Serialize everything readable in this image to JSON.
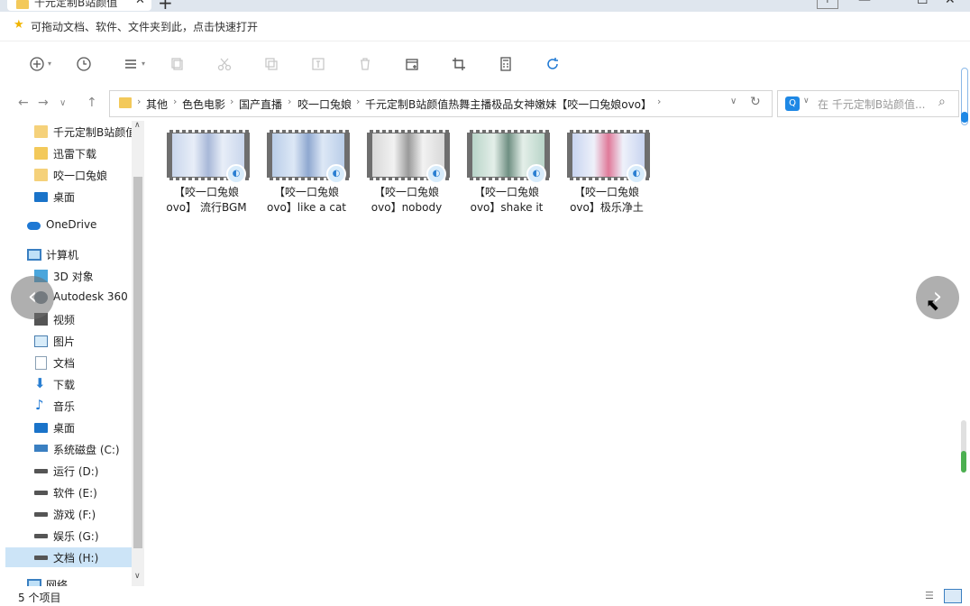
{
  "tab": {
    "title": "千元定制B站颜值",
    "close": "✕",
    "new": "+"
  },
  "window": {
    "minimize": "—",
    "maximize": "☐",
    "close": "✕"
  },
  "quickbar": {
    "text": "可拖动文档、软件、文件夹到此，点击快速打开"
  },
  "breadcrumb": [
    "其他",
    "色色电影",
    "国产直播",
    "咬一口兔娘",
    "千元定制B站颜值热舞主播极品女神嫩妹【咬一口兔娘ovo】"
  ],
  "search": {
    "placeholder": "在 千元定制B站颜值..."
  },
  "sidebar": {
    "items": [
      {
        "label": "千元定制B站颜值"
      },
      {
        "label": "迅雷下载"
      },
      {
        "label": "咬一口兔娘"
      },
      {
        "label": "桌面"
      },
      {
        "label": "OneDrive"
      },
      {
        "label": "计算机"
      },
      {
        "label": "3D 对象"
      },
      {
        "label": "Autodesk 360"
      },
      {
        "label": "视频"
      },
      {
        "label": "图片"
      },
      {
        "label": "文档"
      },
      {
        "label": "下载"
      },
      {
        "label": "音乐"
      },
      {
        "label": "桌面"
      },
      {
        "label": "系统磁盘 (C:)"
      },
      {
        "label": "运行 (D:)"
      },
      {
        "label": "软件 (E:)"
      },
      {
        "label": "游戏 (F:)"
      },
      {
        "label": "娱乐 (G:)"
      },
      {
        "label": "文档 (H:)"
      },
      {
        "label": "网络"
      }
    ]
  },
  "files": [
    {
      "line1": "【咬一口兔娘",
      "line2": "ovo】 流行BGM",
      "palette": [
        "#c9d6ec",
        "#e8eef8",
        "#a8b8d8"
      ]
    },
    {
      "line1": "【咬一口兔娘",
      "line2": "ovo】like a cat",
      "palette": [
        "#b9cde8",
        "#dde8f6",
        "#8fa8d0"
      ]
    },
    {
      "line1": "【咬一口兔娘",
      "line2": "ovo】nobody",
      "palette": [
        "#d8d8d8",
        "#f2f2f2",
        "#9a9a9a"
      ]
    },
    {
      "line1": "【咬一口兔娘",
      "line2": "ovo】shake it",
      "palette": [
        "#b8d4c8",
        "#e4efe9",
        "#6f8f82"
      ]
    },
    {
      "line1": "【咬一口兔娘",
      "line2": "ovo】极乐净土",
      "palette": [
        "#c8d4f0",
        "#eef1fa",
        "#e07a9a"
      ]
    }
  ],
  "status": {
    "count": "5 个项目"
  },
  "overlay": {
    "prev": "‹",
    "next": "›"
  }
}
